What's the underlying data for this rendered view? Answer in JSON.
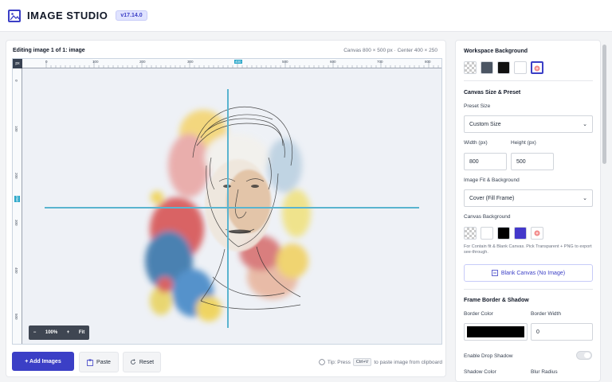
{
  "header": {
    "title": "IMAGE STUDIO",
    "version": "v17.14.0"
  },
  "canvas": {
    "editing_label": "Editing image 1 of 1: image",
    "info": "Canvas 800 × 500 px · Center 400 × 250",
    "ruler_corner": "px",
    "ruler_top": [
      "0",
      "100",
      "200",
      "300",
      "400",
      "500",
      "600",
      "700",
      "800"
    ],
    "ruler_top_active": "400",
    "ruler_left": [
      "0",
      "100",
      "200",
      "250",
      "300",
      "400",
      "500"
    ],
    "ruler_left_active": "250",
    "zoom": {
      "minus": "−",
      "level": "100%",
      "plus": "+",
      "fit": "Fit"
    }
  },
  "actions": {
    "add_images": "+ Add Images",
    "paste": "Paste",
    "reset": "Reset",
    "tip_prefix": "Tip: Press",
    "tip_key": "Ctrl+V",
    "tip_suffix": "to paste image from clipboard"
  },
  "sidebar": {
    "workspace_bg_title": "Workspace Background",
    "canvas_size_title": "Canvas Size & Preset",
    "preset_label": "Preset Size",
    "preset_value": "Custom Size",
    "width_label": "Width (px)",
    "width_value": "800",
    "height_label": "Height (px)",
    "height_value": "500",
    "fit_label": "Image Fit & Background",
    "fit_value": "Cover (Fill Frame)",
    "canvas_bg_label": "Canvas Background",
    "canvas_bg_hint": "For Contain fit & Blank Canvas. Pick Transparent + PNG to export see-through.",
    "blank_canvas": "Blank Canvas (No Image)",
    "frame_title": "Frame Border & Shadow",
    "border_color_label": "Border Color",
    "border_width_label": "Border Width",
    "border_width_value": "0",
    "drop_shadow_label": "Enable Drop Shadow",
    "shadow_color_label": "Shadow Color",
    "blur_radius_label": "Blur Radius"
  },
  "colors": {
    "accent": "#3b3fc6",
    "guide": "#5ab4cf",
    "workspace_swatches": [
      "checker",
      "#4b5563",
      "#111111",
      "#ffffff",
      "picker"
    ],
    "canvas_swatches": [
      "checker",
      "#ffffff",
      "#000000",
      "#4338ca",
      "picker"
    ],
    "border_color": "#000000"
  }
}
